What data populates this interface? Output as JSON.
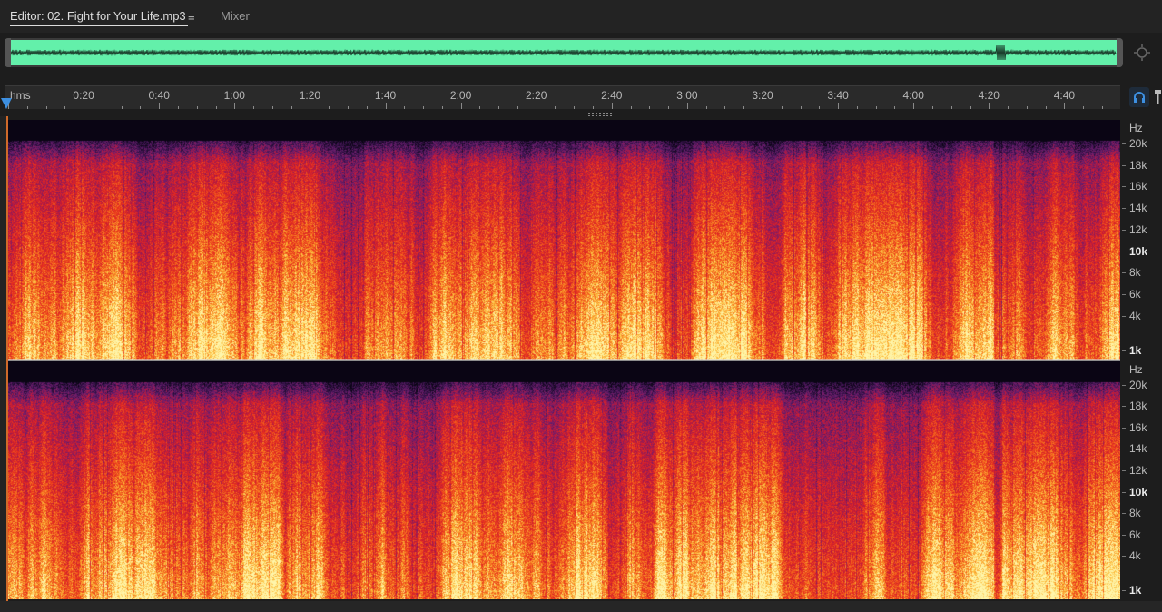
{
  "tabs": {
    "editor_label": "Editor: 02. Fight for Your Life.mp3",
    "menu_glyph": "≡",
    "mixer_label": "Mixer"
  },
  "ruler": {
    "unit": "hms",
    "labels": [
      "0:20",
      "0:40",
      "1:00",
      "1:20",
      "1:40",
      "2:00",
      "2:20",
      "2:40",
      "3:00",
      "3:20",
      "3:40",
      "4:00",
      "4:20",
      "4:40"
    ]
  },
  "hz_axis": {
    "unit": "Hz",
    "labels": [
      {
        "text": "20k",
        "bold": false
      },
      {
        "text": "18k",
        "bold": false
      },
      {
        "text": "16k",
        "bold": false
      },
      {
        "text": "14k",
        "bold": false
      },
      {
        "text": "12k",
        "bold": false
      },
      {
        "text": "10k",
        "bold": true
      },
      {
        "text": "8k",
        "bold": false
      },
      {
        "text": "6k",
        "bold": false
      },
      {
        "text": "4k",
        "bold": false
      },
      {
        "text": "1k",
        "bold": true
      }
    ]
  },
  "colors": {
    "overview_wave": "#63f0aa",
    "playhead": "#3d8fe0",
    "spectrum_low": "#ffe87a",
    "spectrum_mid": "#e8301c",
    "spectrum_high": "#6a1f6e",
    "background": "#1d1d1d"
  },
  "icons": {
    "zoom": "zoom-navigator-icon",
    "snap": "headphones-snap-icon",
    "pin": "pin-icon"
  }
}
